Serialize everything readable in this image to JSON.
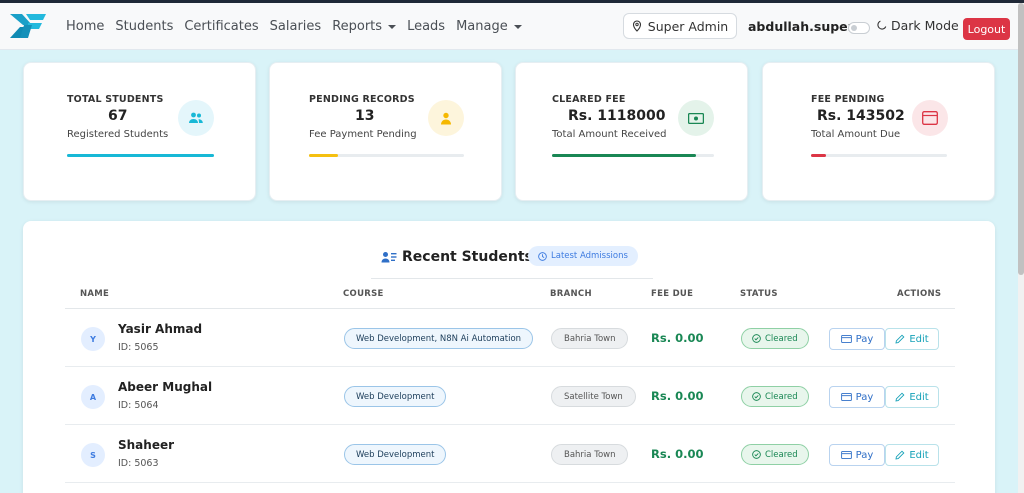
{
  "navbar": {
    "links": [
      {
        "label": "Home"
      },
      {
        "label": "Students"
      },
      {
        "label": "Certificates"
      },
      {
        "label": "Salaries"
      },
      {
        "label": "Reports",
        "dropdown": true
      },
      {
        "label": "Leads"
      },
      {
        "label": "Manage",
        "dropdown": true
      }
    ],
    "role": "Super Admin",
    "username": "abdullah.super",
    "dark_mode_label": "Dark Mode",
    "dark_mode_on": false,
    "logout_label": "Logout"
  },
  "stats": [
    {
      "label": "TOTAL STUDENTS",
      "value": "67",
      "sub": "Registered Students",
      "progress": 1.0,
      "color": "#17b8d6",
      "icon": "users-icon",
      "icon_bg": "#e4f6fb"
    },
    {
      "label": "PENDING RECORDS",
      "value": "13",
      "sub": "Fee Payment Pending",
      "progress": 0.19,
      "color": "#f5c010",
      "icon": "user-icon",
      "icon_bg": "#fdf5dc"
    },
    {
      "label": "CLEARED FEE",
      "value": "Rs. 1118000",
      "sub": "Total Amount Received",
      "progress": 0.89,
      "color": "#198754",
      "icon": "cash-icon",
      "icon_bg": "#e4f3ea"
    },
    {
      "label": "FEE PENDING",
      "value": "Rs. 143502",
      "sub": "Total Amount Due",
      "progress": 0.11,
      "color": "#dc3545",
      "icon": "wallet-icon",
      "icon_bg": "#fbe6e8"
    }
  ],
  "recent": {
    "title": "Recent Students",
    "badge": "Latest Admissions",
    "columns": [
      "NAME",
      "COURSE",
      "BRANCH",
      "FEE DUE",
      "STATUS",
      "ACTIONS"
    ],
    "rows": [
      {
        "initial": "Y",
        "name": "Yasir Ahmad",
        "id": "ID: 5065",
        "course": "Web Development, N8N Ai Automation",
        "branch": "Bahria Town",
        "fee_due": "Rs. 0.00",
        "status": "Cleared",
        "pay": "Pay",
        "edit": "Edit"
      },
      {
        "initial": "A",
        "name": "Abeer Mughal",
        "id": "ID: 5064",
        "course": "Web Development",
        "branch": "Satellite Town",
        "fee_due": "Rs. 0.00",
        "status": "Cleared",
        "pay": "Pay",
        "edit": "Edit"
      },
      {
        "initial": "S",
        "name": "Shaheer",
        "id": "ID: 5063",
        "course": "Web Development",
        "branch": "Bahria Town",
        "fee_due": "Rs. 0.00",
        "status": "Cleared",
        "pay": "Pay",
        "edit": "Edit"
      }
    ]
  },
  "colors": {
    "page_bg": "#d9f3f8",
    "logout": "#dc3545",
    "success": "#198754",
    "accent": "#3d7be0"
  }
}
